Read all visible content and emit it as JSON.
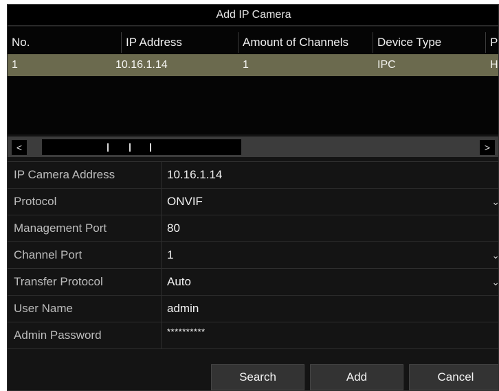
{
  "dialog": {
    "title": "Add IP Camera"
  },
  "table": {
    "columns": [
      "No.",
      "IP Address",
      "Amount of Channels",
      "Device Type",
      "P"
    ],
    "rows": [
      {
        "no": "1",
        "ip": "10.16.1.14",
        "channels": "1",
        "device_type": "IPC",
        "protocol": "H"
      }
    ]
  },
  "scrollbar": {
    "left_arrow": "<",
    "right_arrow": ">"
  },
  "form": {
    "ip_camera_address": {
      "label": "IP Camera Address",
      "value": "10.16.1.14"
    },
    "protocol": {
      "label": "Protocol",
      "value": "ONVIF"
    },
    "management_port": {
      "label": "Management Port",
      "value": "80"
    },
    "channel_port": {
      "label": "Channel Port",
      "value": "1"
    },
    "transfer_protocol": {
      "label": "Transfer Protocol",
      "value": "Auto"
    },
    "user_name": {
      "label": "User Name",
      "value": "admin"
    },
    "admin_password": {
      "label": "Admin Password",
      "value": "**********"
    }
  },
  "buttons": {
    "search": "Search",
    "add": "Add",
    "cancel": "Cancel"
  },
  "colors": {
    "selected_row": "#6b6a4e",
    "background": "#141414",
    "titlebar": "#000000"
  },
  "icons": {
    "dropdown": "chevron-down-icon",
    "scroll_left": "chevron-left-icon",
    "scroll_right": "chevron-right-icon"
  }
}
